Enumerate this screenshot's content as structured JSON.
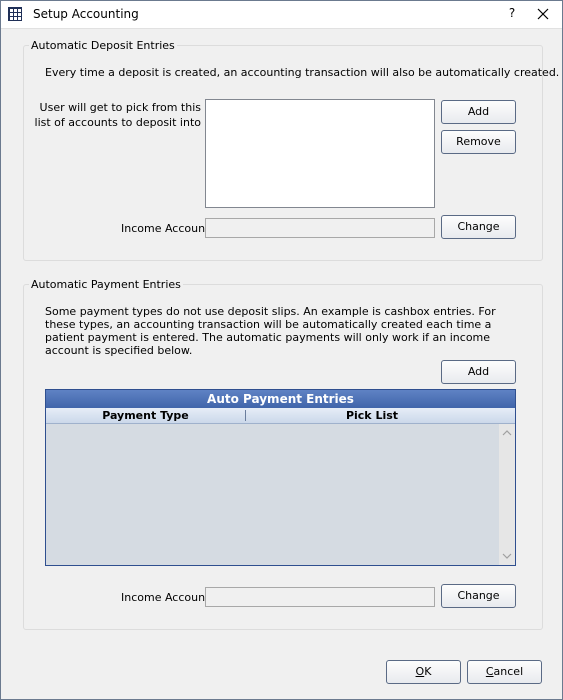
{
  "window": {
    "title": "Setup Accounting",
    "help_label": "?"
  },
  "deposit": {
    "group_title": "Automatic Deposit Entries",
    "description": "Every time a deposit is created, an accounting transaction will also be automatically created.",
    "list_label": "User will get to pick from this list of accounts to deposit into",
    "add_label": "Add",
    "remove_label": "Remove",
    "income_label": "Income Account",
    "income_value": "",
    "change_label": "Change"
  },
  "payment": {
    "group_title": "Automatic Payment Entries",
    "description": "Some payment types do not use deposit slips.  An example is cashbox entries.  For these types, an accounting transaction will be automatically created each time a patient payment is entered.  The automatic payments will only work if an income account is specified below.",
    "add_label": "Add",
    "grid": {
      "title": "Auto Payment Entries",
      "columns": [
        "Payment Type",
        "Pick List"
      ],
      "rows": []
    },
    "income_label": "Income Account",
    "income_value": "",
    "change_label": "Change"
  },
  "footer": {
    "ok_first": "O",
    "ok_rest": "K",
    "cancel_first": "C",
    "cancel_rest": "ancel"
  }
}
